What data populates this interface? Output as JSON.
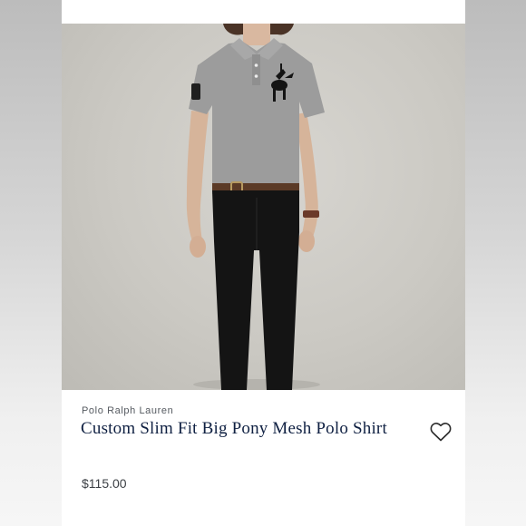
{
  "product": {
    "brand": "Polo Ralph Lauren",
    "title": "Custom Slim Fit Big Pony Mesh Polo Shirt",
    "price": "$115.00"
  },
  "icons": {
    "favorite": "heart-outline-icon"
  },
  "colors": {
    "title": "#0f2042",
    "shirt": "#9c9c9c",
    "pants": "#141414",
    "background": "#ffffff"
  }
}
